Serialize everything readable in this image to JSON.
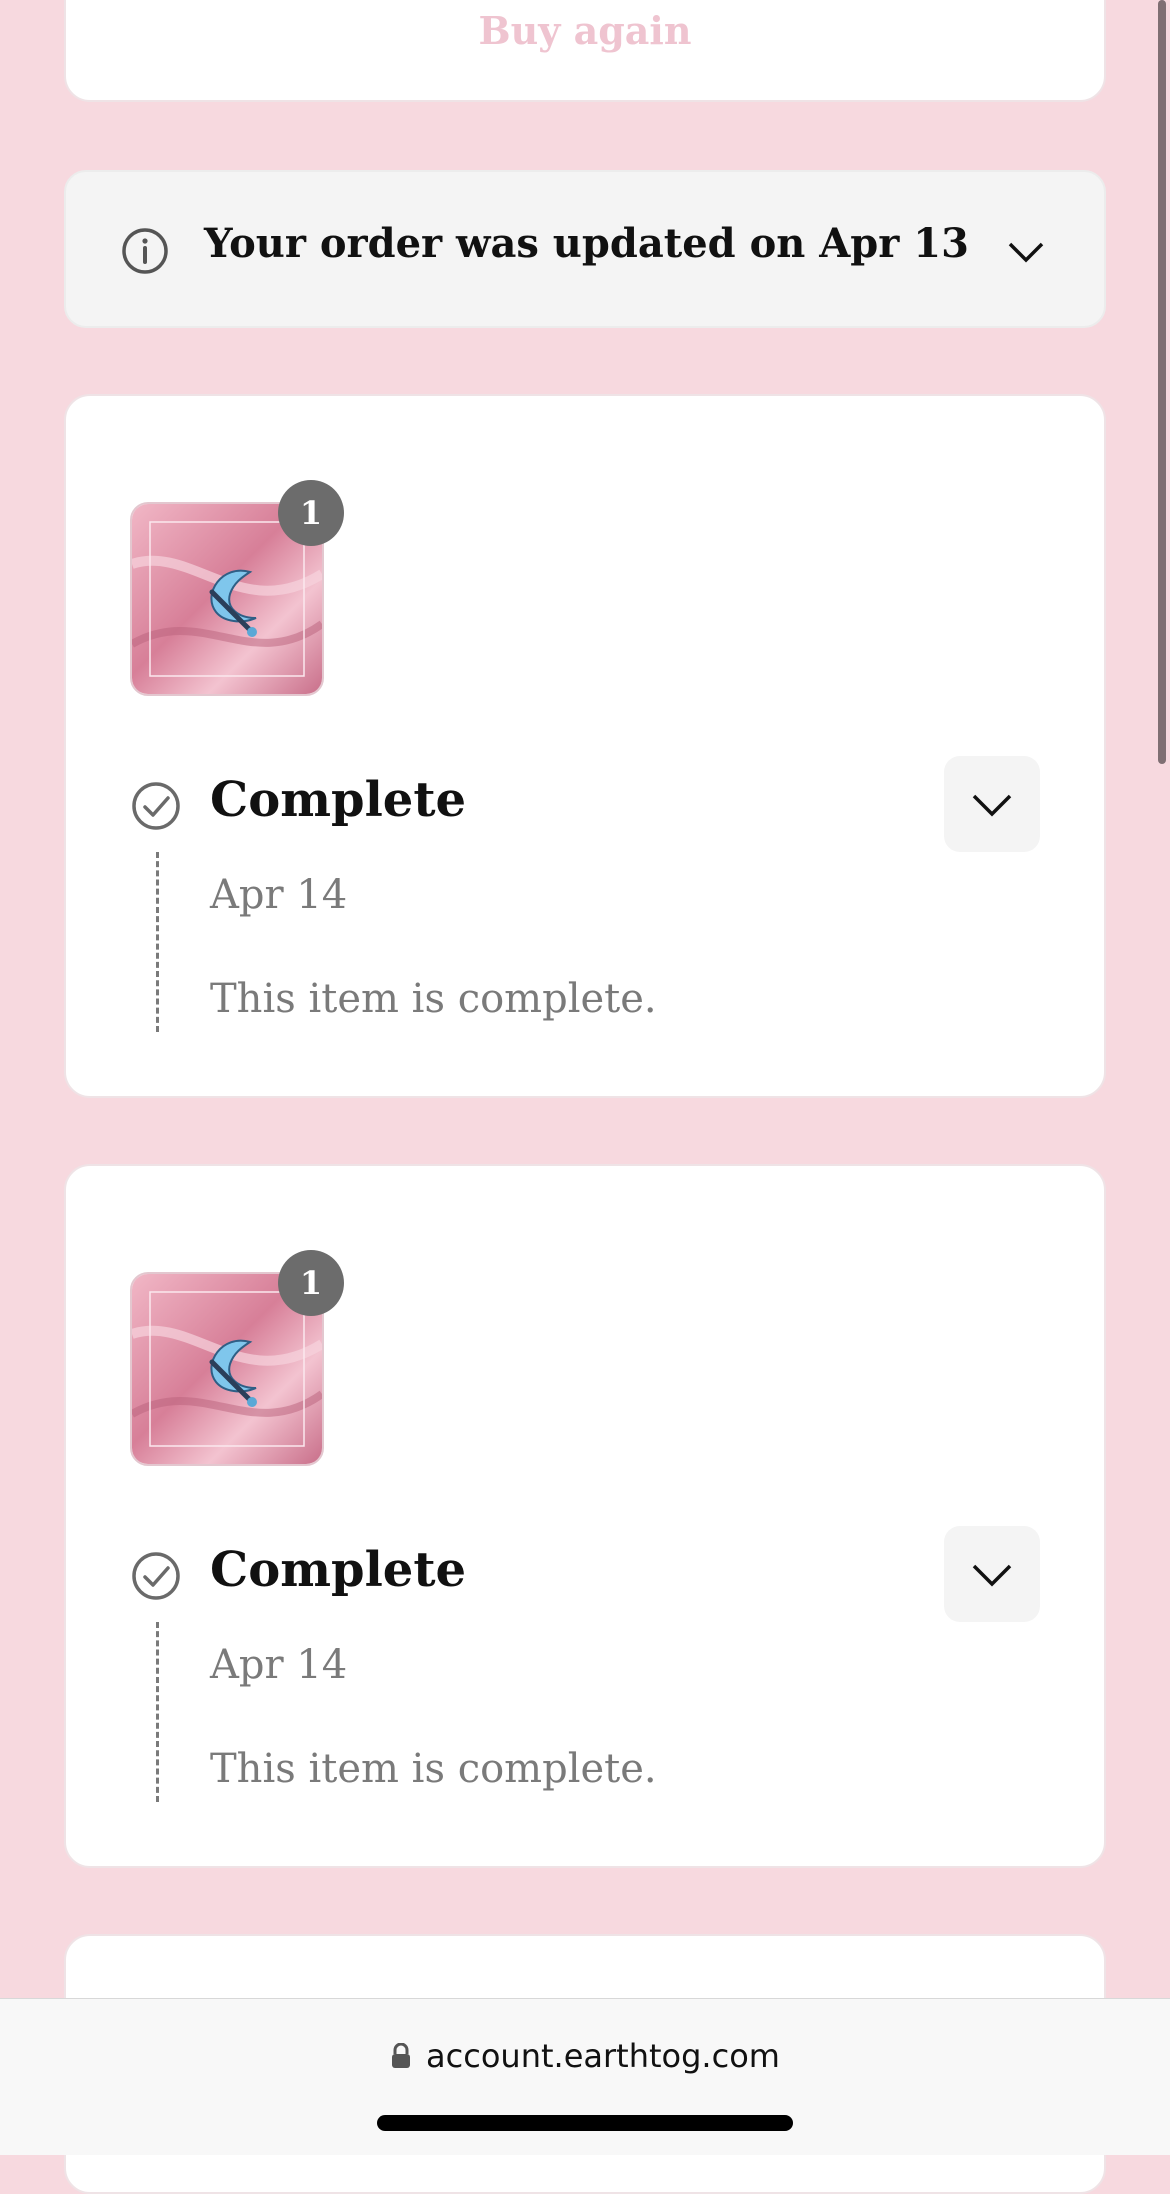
{
  "top_card": {
    "buy_again_label": "Buy again"
  },
  "notice": {
    "text": "Your order was updated on Apr 13"
  },
  "items": [
    {
      "quantity": "1",
      "status": "Complete",
      "date": "Apr 14",
      "description": "This item is complete."
    },
    {
      "quantity": "1",
      "status": "Complete",
      "date": "Apr 14",
      "description": "This item is complete."
    }
  ],
  "browser": {
    "url": "account.earthtog.com"
  },
  "icons": {
    "info": "info-circle-icon",
    "chevron": "chevron-down-icon",
    "check": "check-circle-icon",
    "lock": "lock-icon"
  },
  "colors": {
    "background": "#f7d9df",
    "accent_muted": "#efc4d0",
    "badge": "#6c6c6c"
  }
}
